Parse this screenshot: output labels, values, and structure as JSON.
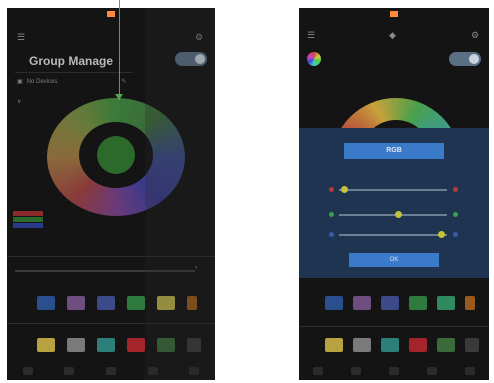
{
  "left_phone": {
    "menu_title": "Group Manage",
    "menu_item": "No Devices",
    "swatches_row1": [
      "#2a4f8e",
      "#6d4e7e",
      "#3c4a8a",
      "#2f7a3f",
      "#b8ae46",
      "#9b5a1b"
    ],
    "swatches_row2": [
      "#b8a23f",
      "#7a7a7a",
      "#2d7f7a",
      "#a3242a",
      "#3a6a3a",
      "#3a3a3a"
    ]
  },
  "right_phone": {
    "dialog": {
      "title": "RGB",
      "ok_label": "OK",
      "rows": [
        {
          "value": 0.05
        },
        {
          "value": 0.55
        },
        {
          "value": 0.95
        }
      ]
    },
    "swatches_row1": [
      "#2a4f8e",
      "#6d4e7e",
      "#3c4a8a",
      "#2f7a3f",
      "#2f8a5f",
      "#9b5a1b"
    ],
    "swatches_row2": [
      "#b8a23f",
      "#7a7a7a",
      "#2d7f7a",
      "#a3242a",
      "#3a6a3a",
      "#3a3a3a"
    ]
  }
}
